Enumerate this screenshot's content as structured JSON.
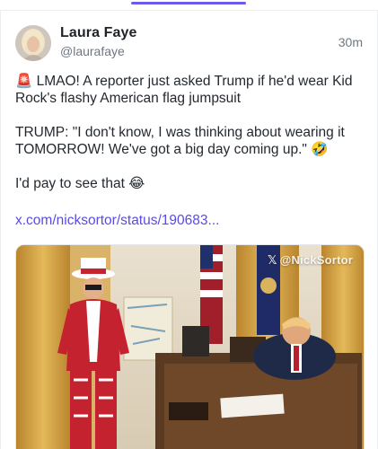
{
  "header": {
    "active_tab_color": "#6b5cf0"
  },
  "post": {
    "author_name": "Laura Faye",
    "author_handle": "@laurafaye",
    "time": "30m",
    "paragraphs": [
      "🚨 LMAO! A reporter just asked Trump if he'd wear Kid Rock's flashy American flag jumpsuit",
      "TRUMP: \"I don't know, I was thinking about wearing it TOMORROW! We've got a big day coming up.\" 🤣",
      "I'd pay to see that 😂"
    ],
    "link_text": "x.com/nicksortor/status/190683...",
    "media": {
      "watermark_icon": "x-logo-icon",
      "watermark_text": "@NickSortor"
    }
  },
  "colors": {
    "link": "#5a4be3",
    "muted": "#6e7681"
  }
}
